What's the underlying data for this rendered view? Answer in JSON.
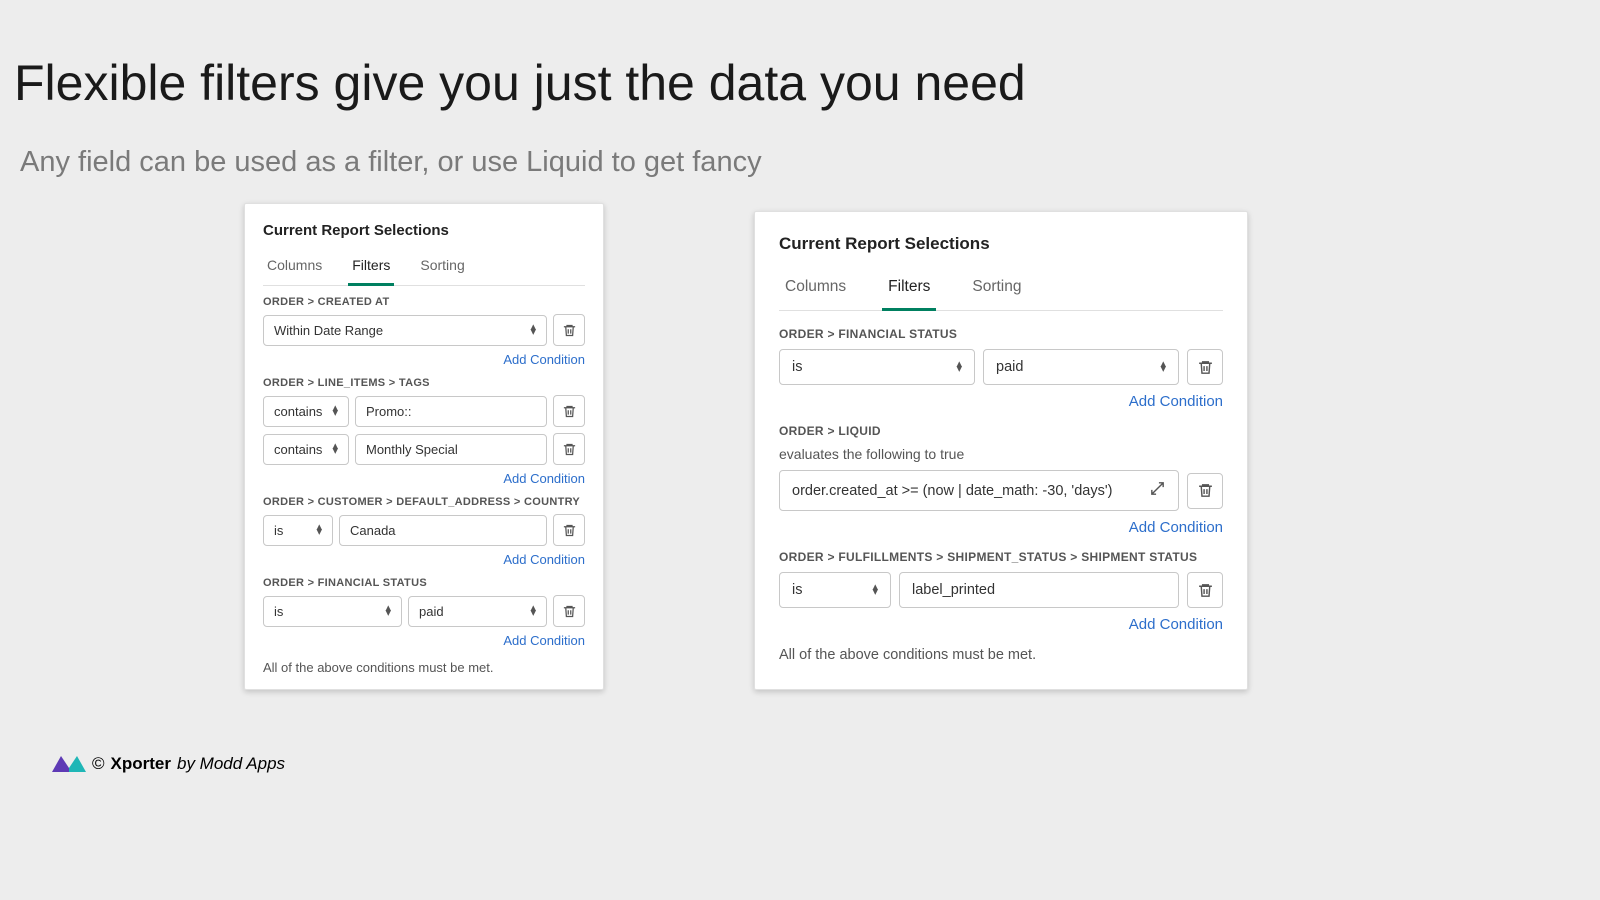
{
  "heading": "Flexible filters give you just the data you need",
  "subheading": "Any field can be used as a filter, or use Liquid to get fancy",
  "tabs": {
    "columns": "Columns",
    "filters": "Filters",
    "sorting": "Sorting"
  },
  "common": {
    "card_title": "Current Report Selections",
    "add_condition": "Add Condition",
    "footer_note": "All of the above conditions must be met."
  },
  "left": {
    "groups": [
      {
        "label": "ORDER > CREATED AT",
        "rows": [
          {
            "select_full": "Within Date Range"
          }
        ]
      },
      {
        "label": "ORDER > LINE_ITEMS > TAGS",
        "rows": [
          {
            "select": "contains",
            "input": "Promo::"
          },
          {
            "select": "contains",
            "input": "Monthly Special"
          }
        ]
      },
      {
        "label": "ORDER > CUSTOMER > DEFAULT_ADDRESS > COUNTRY",
        "rows": [
          {
            "select": "is",
            "input": "Canada"
          }
        ]
      },
      {
        "label": "ORDER > FINANCIAL STATUS",
        "rows": [
          {
            "select": "is",
            "select2": "paid"
          }
        ]
      }
    ]
  },
  "right": {
    "groups": [
      {
        "label": "ORDER > FINANCIAL STATUS",
        "rows": [
          {
            "select": "is",
            "select2": "paid"
          }
        ]
      },
      {
        "label": "ORDER > LIQUID",
        "sub_label": "evaluates the following to true",
        "rows": [
          {
            "liquid": "order.created_at >= (now | date_math: -30, 'days')"
          }
        ]
      },
      {
        "label": "ORDER > FULFILLMENTS > SHIPMENT_STATUS > SHIPMENT STATUS",
        "rows": [
          {
            "select": "is",
            "input": "label_printed"
          }
        ]
      }
    ]
  },
  "brand": {
    "copyright": "©",
    "name": "Xporter",
    "by": "by Modd Apps"
  }
}
